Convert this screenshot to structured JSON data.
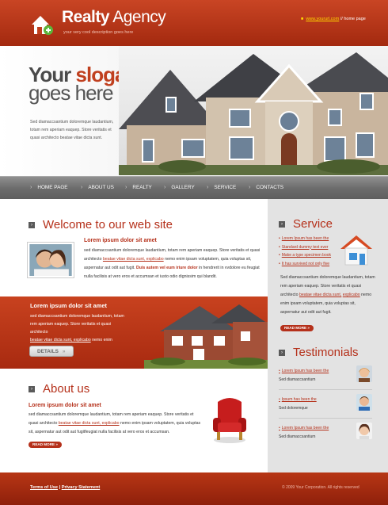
{
  "header": {
    "brand_bold": "Realty",
    "brand_light": " Agency",
    "tagline": "your very cool description goes here",
    "site_link": "www.yoururl.com",
    "separator": " //",
    "home_link": "home page"
  },
  "hero": {
    "slogan_your": "Your",
    "slogan_word": "slogan",
    "slogan_line2": "goes here",
    "description": "Sed diamaccsantium doloremque laudantium, totam rem aperiam eaquep. Store veritatis et quasi architecto beatae vitae dicta sunt."
  },
  "nav": {
    "items": [
      {
        "label": "HOME PAGE"
      },
      {
        "label": "ABOUT US"
      },
      {
        "label": "REALTY"
      },
      {
        "label": "GALLERY"
      },
      {
        "label": "SERVICE"
      },
      {
        "label": "CONTACTS"
      }
    ]
  },
  "welcome": {
    "title": "Welcome to our web site",
    "heading": "Lorem ipsum dolor sit amet",
    "body_pre": "sed diamaccsantium doloremque laudantium, totam rem aperiam eaquep. Store veritatis et quasi architecto ",
    "body_link": "beatae vitae dicta sunt, explicabo",
    "body_mid": " nemo enim ipsam voluptatem, quia voluptas sit, aspernatur aut odit aut fugit. ",
    "body_highlight": "Duis autem vel eum iriure dolor",
    "body_post": " in hendrerit in vvdolore eu feugiat nulla facilisis at vero eros et accumsan et iusto odio dignissim qui blandit."
  },
  "band": {
    "heading": "Lorem ipsum dolor sit amet",
    "body": "sed diamaccsantium doloremque laudantium, totam rem aperiam eaquep. Store veritatis et quasi architecto",
    "link": "beatae vitae dicta sunt, explicabo",
    "link_post": " nemo enim",
    "button": "DETAILS",
    "button_arrow": "»"
  },
  "about": {
    "title": "About us",
    "heading": "Lorem ipsum dolor sit amet",
    "body_pre": "sed diamaccsantium doloremque laudantium, totam rem aperiam eaquep. Store veritatis et quasi architecto ",
    "body_link": "beatae vitae dicta sunt, explicabo",
    "body_post": " nemo enim ipsam voluptatem, quia voluptas sit, aspernatur aut odit aut fugitfeugiat nulla facilisis at vero eros et accumsan.",
    "readmore": "READ MORE »"
  },
  "service": {
    "title": "Service",
    "items": [
      {
        "label": "Lorem Ipsum has been the"
      },
      {
        "label": "Standard dummy text ever"
      },
      {
        "label": "Make a type specimen book"
      },
      {
        "label": "It has survived not only five"
      }
    ],
    "body_pre": "Sed diamaccsantium doloremque laudantium, totam rem aperiam eaquep. Store veritatis et quasi architecto ",
    "body_link1": "beatae vitae dicta sunt,",
    "body_link2": "explicabo",
    "body_post": " nemo enim ipsam voluptatem, quia voluptas sit, aspernatur aut odit aut fugit.",
    "readmore": "READ MORE »"
  },
  "testimonials": {
    "title": "Testimonials",
    "items": [
      {
        "link": "Lorem Ipsum has been the",
        "text": "Sed diamaccsantium"
      },
      {
        "link": "Ipsum has been the",
        "text": "Sed doloremque"
      },
      {
        "link": "Lorem Ipsum has been the",
        "text": "Sed diamaccsantium"
      }
    ]
  },
  "footer": {
    "terms": "Terms of Use",
    "divider": " | ",
    "privacy": "Privacy Statement",
    "copyright": "© 2009 Your Corporation.  All rights reserved"
  },
  "colors": {
    "accent": "#b5301a",
    "header": "#c0401f",
    "nav": "#6d6d6d",
    "sidebar": "#e3e3e3"
  }
}
